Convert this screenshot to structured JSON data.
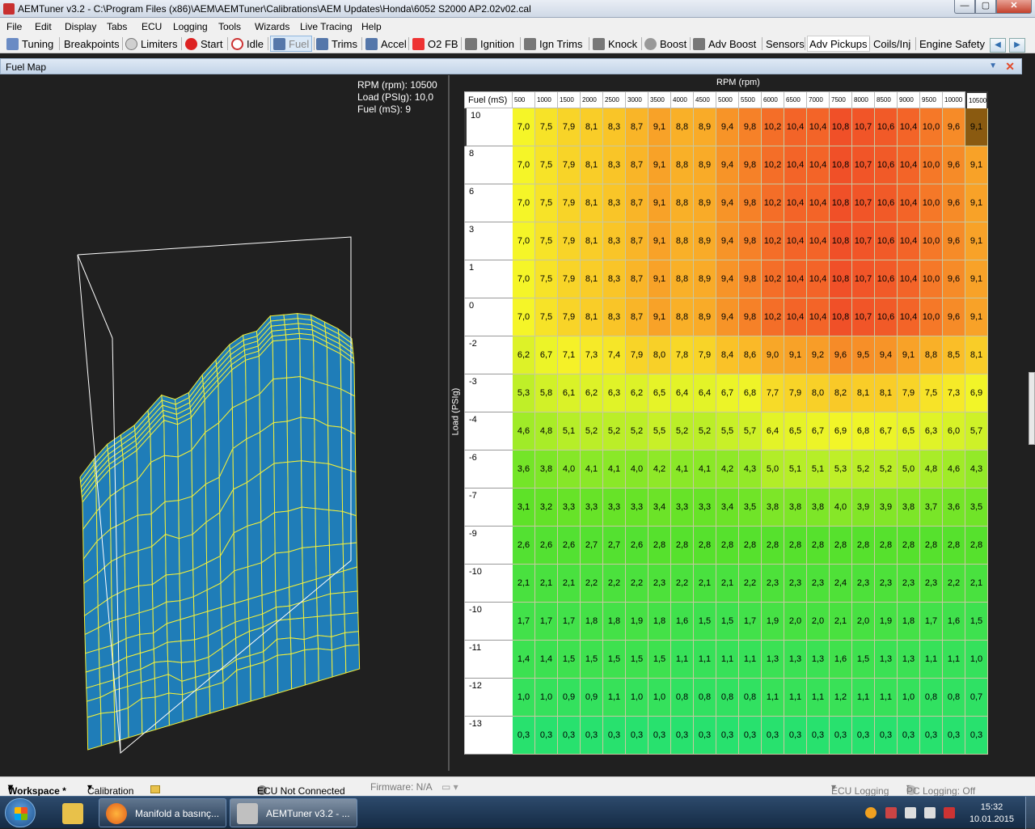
{
  "window": {
    "title": "AEMTuner v3.2 - C:\\Program Files (x86)\\AEM\\AEMTuner\\Calibrations\\AEM Updates\\Honda\\6052 S2000 AP2.02v02.cal"
  },
  "menu": [
    "File",
    "Edit",
    "Display",
    "Tabs",
    "ECU",
    "Logging",
    "Tools",
    "Wizards",
    "Live Tracing",
    "Help"
  ],
  "toolbar": [
    {
      "label": "Tuning",
      "icon": "chart-icon"
    },
    {
      "label": "Breakpoints",
      "icon": "none"
    },
    {
      "label": "Limiters",
      "icon": "gauge-icon"
    },
    {
      "label": "Start",
      "icon": "start-icon"
    },
    {
      "label": "Idle",
      "icon": "idle-icon"
    },
    {
      "label": "Fuel",
      "icon": "injector-icon"
    },
    {
      "label": "Trims",
      "icon": "injector-icon"
    },
    {
      "label": "Accel",
      "icon": "injector-icon"
    },
    {
      "label": "O2 FB",
      "icon": "o2-icon"
    },
    {
      "label": "Ignition",
      "icon": "coil-icon"
    },
    {
      "label": "Ign Trims",
      "icon": "coil-icon"
    },
    {
      "label": "Knock",
      "icon": "coil-icon"
    },
    {
      "label": "Boost",
      "icon": "turbo-icon"
    },
    {
      "label": "Adv Boost",
      "icon": "coil-icon"
    },
    {
      "label": "Sensors",
      "icon": "none"
    },
    {
      "label": "Adv Pickups",
      "icon": "none"
    },
    {
      "label": "Coils/Inj",
      "icon": "none"
    },
    {
      "label": "Engine Safety",
      "icon": "none"
    }
  ],
  "panel": {
    "title": "Fuel Map"
  },
  "readout": {
    "rpm": "RPM (rpm): 10500",
    "load": "Load (PSIg): 10,0",
    "fuel": "Fuel (mS): 9"
  },
  "table": {
    "x_title": "RPM (rpm)",
    "y_title": "Load (PSIg)",
    "corner": "Fuel (mS)",
    "cols": [
      "500",
      "1000",
      "1500",
      "2000",
      "2500",
      "3000",
      "3500",
      "4000",
      "4500",
      "5000",
      "5500",
      "6000",
      "6500",
      "7000",
      "7500",
      "8000",
      "8500",
      "9000",
      "9500",
      "10000",
      "10500"
    ],
    "rows": [
      "10",
      "8",
      "6",
      "3",
      "1",
      "0",
      "-2",
      "-3",
      "-4",
      "-6",
      "-7",
      "-9",
      "-10",
      "-10",
      "-11",
      "-12",
      "-13"
    ],
    "values": [
      [
        "7,0",
        "7,5",
        "7,9",
        "8,1",
        "8,3",
        "8,7",
        "9,1",
        "8,8",
        "8,9",
        "9,4",
        "9,8",
        "10,2",
        "10,4",
        "10,4",
        "10,8",
        "10,7",
        "10,6",
        "10,4",
        "10,0",
        "9,6",
        "9,1"
      ],
      [
        "7,0",
        "7,5",
        "7,9",
        "8,1",
        "8,3",
        "8,7",
        "9,1",
        "8,8",
        "8,9",
        "9,4",
        "9,8",
        "10,2",
        "10,4",
        "10,4",
        "10,8",
        "10,7",
        "10,6",
        "10,4",
        "10,0",
        "9,6",
        "9,1"
      ],
      [
        "7,0",
        "7,5",
        "7,9",
        "8,1",
        "8,3",
        "8,7",
        "9,1",
        "8,8",
        "8,9",
        "9,4",
        "9,8",
        "10,2",
        "10,4",
        "10,4",
        "10,8",
        "10,7",
        "10,6",
        "10,4",
        "10,0",
        "9,6",
        "9,1"
      ],
      [
        "7,0",
        "7,5",
        "7,9",
        "8,1",
        "8,3",
        "8,7",
        "9,1",
        "8,8",
        "8,9",
        "9,4",
        "9,8",
        "10,2",
        "10,4",
        "10,4",
        "10,8",
        "10,7",
        "10,6",
        "10,4",
        "10,0",
        "9,6",
        "9,1"
      ],
      [
        "7,0",
        "7,5",
        "7,9",
        "8,1",
        "8,3",
        "8,7",
        "9,1",
        "8,8",
        "8,9",
        "9,4",
        "9,8",
        "10,2",
        "10,4",
        "10,4",
        "10,8",
        "10,7",
        "10,6",
        "10,4",
        "10,0",
        "9,6",
        "9,1"
      ],
      [
        "7,0",
        "7,5",
        "7,9",
        "8,1",
        "8,3",
        "8,7",
        "9,1",
        "8,8",
        "8,9",
        "9,4",
        "9,8",
        "10,2",
        "10,4",
        "10,4",
        "10,8",
        "10,7",
        "10,6",
        "10,4",
        "10,0",
        "9,6",
        "9,1"
      ],
      [
        "6,2",
        "6,7",
        "7,1",
        "7,3",
        "7,4",
        "7,9",
        "8,0",
        "7,8",
        "7,9",
        "8,4",
        "8,6",
        "9,0",
        "9,1",
        "9,2",
        "9,6",
        "9,5",
        "9,4",
        "9,1",
        "8,8",
        "8,5",
        "8,1"
      ],
      [
        "5,3",
        "5,8",
        "6,1",
        "6,2",
        "6,3",
        "6,2",
        "6,5",
        "6,4",
        "6,4",
        "6,7",
        "6,8",
        "7,7",
        "7,9",
        "8,0",
        "8,2",
        "8,1",
        "8,1",
        "7,9",
        "7,5",
        "7,3",
        "6,9"
      ],
      [
        "4,6",
        "4,8",
        "5,1",
        "5,2",
        "5,2",
        "5,2",
        "5,5",
        "5,2",
        "5,2",
        "5,5",
        "5,7",
        "6,4",
        "6,5",
        "6,7",
        "6,9",
        "6,8",
        "6,7",
        "6,5",
        "6,3",
        "6,0",
        "5,7"
      ],
      [
        "3,6",
        "3,8",
        "4,0",
        "4,1",
        "4,1",
        "4,0",
        "4,2",
        "4,1",
        "4,1",
        "4,2",
        "4,3",
        "5,0",
        "5,1",
        "5,1",
        "5,3",
        "5,2",
        "5,2",
        "5,0",
        "4,8",
        "4,6",
        "4,3"
      ],
      [
        "3,1",
        "3,2",
        "3,3",
        "3,3",
        "3,3",
        "3,3",
        "3,4",
        "3,3",
        "3,3",
        "3,4",
        "3,5",
        "3,8",
        "3,8",
        "3,8",
        "4,0",
        "3,9",
        "3,9",
        "3,8",
        "3,7",
        "3,6",
        "3,5"
      ],
      [
        "2,6",
        "2,6",
        "2,6",
        "2,7",
        "2,7",
        "2,6",
        "2,8",
        "2,8",
        "2,8",
        "2,8",
        "2,8",
        "2,8",
        "2,8",
        "2,8",
        "2,8",
        "2,8",
        "2,8",
        "2,8",
        "2,8",
        "2,8",
        "2,8"
      ],
      [
        "2,1",
        "2,1",
        "2,1",
        "2,2",
        "2,2",
        "2,2",
        "2,3",
        "2,2",
        "2,1",
        "2,1",
        "2,2",
        "2,3",
        "2,3",
        "2,3",
        "2,4",
        "2,3",
        "2,3",
        "2,3",
        "2,3",
        "2,2",
        "2,1"
      ],
      [
        "1,7",
        "1,7",
        "1,7",
        "1,8",
        "1,8",
        "1,9",
        "1,8",
        "1,6",
        "1,5",
        "1,5",
        "1,7",
        "1,9",
        "2,0",
        "2,0",
        "2,1",
        "2,0",
        "1,9",
        "1,8",
        "1,7",
        "1,6",
        "1,5"
      ],
      [
        "1,4",
        "1,4",
        "1,5",
        "1,5",
        "1,5",
        "1,5",
        "1,5",
        "1,1",
        "1,1",
        "1,1",
        "1,1",
        "1,3",
        "1,3",
        "1,3",
        "1,6",
        "1,5",
        "1,3",
        "1,3",
        "1,1",
        "1,1",
        "1,0"
      ],
      [
        "1,0",
        "1,0",
        "0,9",
        "0,9",
        "1,1",
        "1,0",
        "1,0",
        "0,8",
        "0,8",
        "0,8",
        "0,8",
        "1,1",
        "1,1",
        "1,1",
        "1,2",
        "1,1",
        "1,1",
        "1,0",
        "0,8",
        "0,8",
        "0,7"
      ],
      [
        "0,3",
        "0,3",
        "0,3",
        "0,3",
        "0,3",
        "0,3",
        "0,3",
        "0,3",
        "0,3",
        "0,3",
        "0,3",
        "0,3",
        "0,3",
        "0,3",
        "0,3",
        "0,3",
        "0,3",
        "0,3",
        "0,3",
        "0,3",
        "0,3"
      ]
    ],
    "selected": {
      "row": 0,
      "col": 20
    }
  },
  "colors": {
    "surface": "#1f7db8",
    "grid": "#f2ef3a",
    "selected_cell": "#8a5a10"
  },
  "status": {
    "workspace": "Workspace *",
    "calibration": "Calibration",
    "ecu": "ECU Not Connected",
    "firmware": "Firmware: N/A",
    "ecu_logging": "ECU Logging",
    "pc_logging": "PC Logging: Off"
  },
  "taskbar": {
    "items": [
      {
        "label": "Manifold a basınç...",
        "icon": "firefox-icon"
      },
      {
        "label": "AEMTuner v3.2 - ...",
        "icon": "aemtuner-icon"
      }
    ],
    "time": "15:32",
    "date": "10.01.2015"
  }
}
